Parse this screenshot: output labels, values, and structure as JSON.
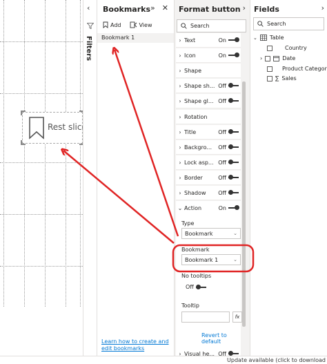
{
  "canvas": {
    "button_text": "Rest slicer"
  },
  "filters": {
    "label": "Filters",
    "collapse_glyph": "‹",
    "icon": "funnel-icon"
  },
  "bookmarks": {
    "title": "Bookmarks",
    "expand_glyph": "»",
    "close_glyph": "✕",
    "add_label": "Add",
    "view_label": "View",
    "items": [
      "Bookmark 1"
    ],
    "help_link": "Learn how to create and edit bookmarks"
  },
  "format": {
    "title": "Format button",
    "nav_glyph": "›",
    "search_placeholder": "Search",
    "rows": [
      {
        "label": "Text",
        "toggle": "On"
      },
      {
        "label": "Icon",
        "toggle": "On"
      },
      {
        "label": "Shape",
        "toggle": ""
      },
      {
        "label": "Shape sh...",
        "toggle": "Off"
      },
      {
        "label": "Shape gl...",
        "toggle": "Off"
      },
      {
        "label": "Rotation",
        "toggle": ""
      },
      {
        "label": "Title",
        "toggle": "Off"
      },
      {
        "label": "Backgro...",
        "toggle": "Off"
      },
      {
        "label": "Lock asp...",
        "toggle": "Off"
      },
      {
        "label": "Border",
        "toggle": "Off"
      },
      {
        "label": "Shadow",
        "toggle": "Off"
      },
      {
        "label": "Action",
        "toggle": "On"
      }
    ],
    "action": {
      "type_label": "Type",
      "type_value": "Bookmark",
      "bookmark_label": "Bookmark",
      "bookmark_value": "Bookmark 1",
      "tooltips_label": "No tooltips",
      "tooltips_toggle": "Off",
      "tooltip_label": "Tooltip",
      "fx_label": "fx",
      "revert_label": "Revert to default"
    },
    "visual_header_row": {
      "label": "Visual he...",
      "toggle": "Off"
    }
  },
  "fields": {
    "title": "Fields",
    "nav_glyph": "›",
    "search_placeholder": "Search",
    "table_name": "Table",
    "items": [
      "Country",
      "Date",
      "Product Category",
      "Sales"
    ]
  },
  "status_bar": {
    "text": "Update available (click to download"
  },
  "colors": {
    "annotation_red": "#e02424",
    "link_blue": "#0078d4",
    "pane_bg": "#f3f2f1"
  }
}
